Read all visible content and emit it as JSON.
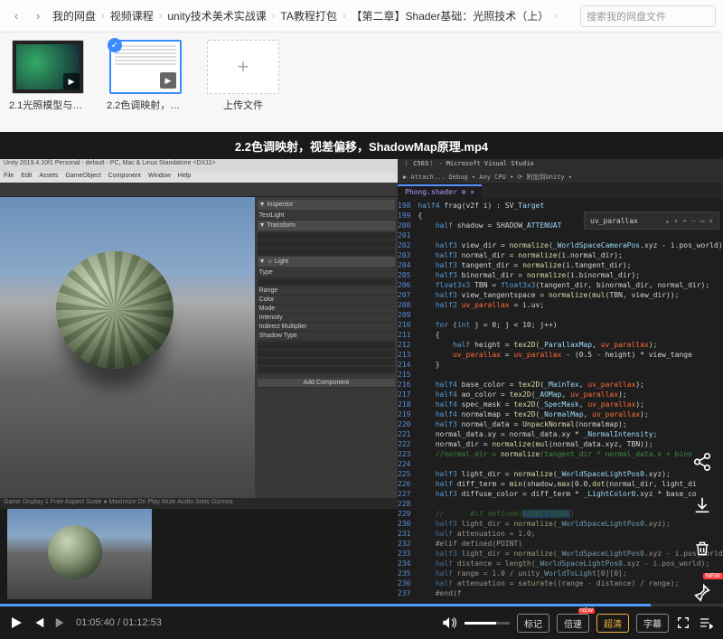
{
  "breadcrumbs": [
    "我的网盘",
    "视频课程",
    "unity技术美术实战课",
    "TA教程打包",
    "【第二章】Shader基础：光照技术（上）"
  ],
  "search": {
    "placeholder": "搜索我的网盘文件"
  },
  "files": [
    {
      "label": "2.1光照模型与法..."
    },
    {
      "label": "2.2色调映射，视..."
    },
    {
      "label": "上传文件"
    }
  ],
  "video": {
    "title": "2.2色调映射，视差偏移，ShadowMap原理.mp4",
    "current_time": "01:05:40",
    "duration": "01:12:53"
  },
  "unity": {
    "title": "Unity 2019.4.10f1 Personal - default - PC, Mac & Linux Standalone <DX11>",
    "menu": [
      "File",
      "Edit",
      "Assets",
      "GameObject",
      "Component",
      "Window",
      "Help"
    ],
    "inspector": {
      "header": "▼ Inspector",
      "name": "TestLight",
      "transform": "▼ Transform",
      "light": "▼ ☼ Light",
      "type": "Type",
      "range": "Range",
      "color": "Color",
      "mode": "Mode",
      "intensity": "Intensity",
      "indirect": "Indirect Multiplier",
      "shadow": "Shadow Type",
      "addcomp": "Add Component"
    },
    "game_tabs": "Game  Display 1  Free Aspect  Scale ●  Maximize On Play  Mute Audio  Stats  Gizmos"
  },
  "vs": {
    "title": "⋮ C503⋮ - Microsoft Visual Studio",
    "toolbar": "▶ Attach...   Debug ▾   Any CPU ▾    ⟳ 附加到Unity ▾",
    "tab1": "Phong.shader ⊕ ×",
    "float_label": "uv_parallax",
    "line_start": 198,
    "code": [
      "half4 frag(v2f i) : SV_Target",
      "{",
      "    half shadow = SHADOW_ATTENUAT",
      "",
      "    half3 view_dir = normalize(_WorldSpaceCameraPos.xyz - i.pos_world);",
      "    half3 normal_dir = normalize(i.normal_dir);",
      "    half3 tangent_dir = normalize(i.tangent_dir);",
      "    half3 binormal_dir = normalize(i.binormal_dir);",
      "    float3x3 TBN = float3x3(tangent_dir, binormal_dir, normal_dir);",
      "    half3 view_tangentspace = normalize(mul(TBN, view_dir));",
      "    half2 uv_parallax = i.uv;",
      "",
      "    for (int j = 0; j < 10; j++)",
      "    {",
      "        half height = tex2D(_ParallaxMap, uv_parallax);",
      "        uv_parallax = uv_parallax - (0.5 - height) * view_tange",
      "    }",
      "",
      "    half4 base_color = tex2D(_MainTex, uv_parallax);",
      "    half4 ao_color = tex2D(_AOMap, uv_parallax);",
      "    half4 spec_mask = tex2D(_SpecMask, uv_parallax);",
      "    half4 normalmap = tex2D(_NormalMap, uv_parallax);",
      "    half3 normal_data = UnpackNormal(normalmap);",
      "    normal_data.xy = normal_data.xy * _NormalIntensity;",
      "    normal_dir = normalize(mul(normal_data.xyz, TBN));",
      "    //normal_dir = normalize(tangent_dir * normal_data.x + bino",
      "",
      "    half3 light_dir = normalize(_WorldSpaceLightPos0.xyz);",
      "    half diff_term = min(shadow,max(0.0,dot(normal_dir, light_di",
      "    half3 diffuse_color = diff_term * _LightColor0.xyz * base_co",
      "",
      "    //      #if defined(DIRECTIONAL)",
      "    half3 light_dir = normalize(_WorldSpaceLightPos0.xyz);",
      "    half attenuation = 1.0;",
      "    #elif defined(POINT)",
      "    half3 light_dir = normalize(_WorldSpaceLightPos0.xyz - i.pos_world);",
      "    half distance = length(_WorldSpaceLightPos0.xyz - i.pos_world);",
      "    half range = 1.0 / unity_WorldToLight[0][0];",
      "    half attenuation = saturate((range - distance) / range);",
      "    #endif"
    ]
  },
  "controls": {
    "mark": "标记",
    "speed": "倍速",
    "quality": "超清",
    "subtitle": "字幕"
  }
}
